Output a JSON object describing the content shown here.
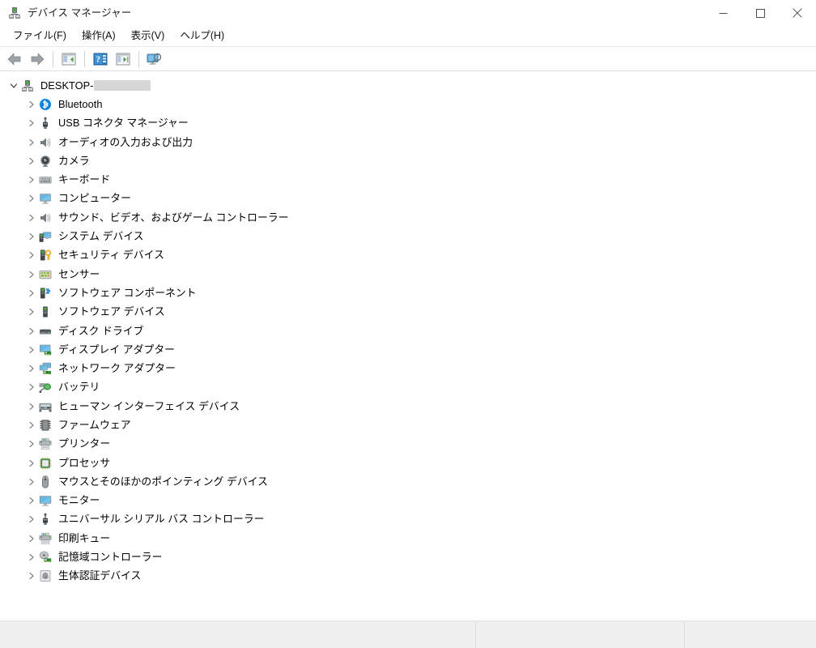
{
  "window": {
    "title": "デバイス マネージャー",
    "icon": "device-manager-icon",
    "controls": {
      "minimize": "最小化",
      "maximize": "最大化",
      "close": "閉じる"
    }
  },
  "menubar": {
    "items": [
      {
        "label": "ファイル(F)",
        "name": "menu-file"
      },
      {
        "label": "操作(A)",
        "name": "menu-action"
      },
      {
        "label": "表示(V)",
        "name": "menu-view"
      },
      {
        "label": "ヘルプ(H)",
        "name": "menu-help"
      }
    ]
  },
  "toolbar": {
    "buttons": [
      {
        "name": "back-button",
        "icon": "back-arrow-icon",
        "title": "戻る"
      },
      {
        "name": "forward-button",
        "icon": "forward-arrow-icon",
        "title": "進む"
      },
      {
        "name": "show-hide-console-tree-button",
        "icon": "console-tree-icon",
        "title": "コンソール ツリーの表示/非表示"
      },
      {
        "name": "help-button",
        "icon": "help-icon",
        "title": "ヘルプ"
      },
      {
        "name": "properties-button",
        "icon": "properties-icon",
        "title": "プロパティ"
      },
      {
        "name": "scan-hardware-changes-button",
        "icon": "scan-hardware-icon",
        "title": "ハードウェア変更のスキャン"
      }
    ]
  },
  "tree": {
    "root": {
      "label_prefix": "DESKTOP-",
      "label_redacted": true,
      "icon": "computer-root-icon",
      "expanded": true
    },
    "nodes": [
      {
        "label": "Bluetooth",
        "icon": "bluetooth-icon"
      },
      {
        "label": "USB コネクタ マネージャー",
        "icon": "usb-connector-icon"
      },
      {
        "label": "オーディオの入力および出力",
        "icon": "audio-icon"
      },
      {
        "label": "カメラ",
        "icon": "camera-icon"
      },
      {
        "label": "キーボード",
        "icon": "keyboard-icon"
      },
      {
        "label": "コンピューター",
        "icon": "computer-icon"
      },
      {
        "label": "サウンド、ビデオ、およびゲーム コントローラー",
        "icon": "audio-icon"
      },
      {
        "label": "システム デバイス",
        "icon": "system-device-icon"
      },
      {
        "label": "セキュリティ デバイス",
        "icon": "security-device-icon"
      },
      {
        "label": "センサー",
        "icon": "sensor-icon"
      },
      {
        "label": "ソフトウェア コンポーネント",
        "icon": "software-component-icon"
      },
      {
        "label": "ソフトウェア デバイス",
        "icon": "software-device-icon"
      },
      {
        "label": "ディスク ドライブ",
        "icon": "disk-drive-icon"
      },
      {
        "label": "ディスプレイ アダプター",
        "icon": "display-adapter-icon"
      },
      {
        "label": "ネットワーク アダプター",
        "icon": "network-adapter-icon"
      },
      {
        "label": "バッテリ",
        "icon": "battery-icon"
      },
      {
        "label": "ヒューマン インターフェイス デバイス",
        "icon": "hid-icon"
      },
      {
        "label": "ファームウェア",
        "icon": "firmware-icon"
      },
      {
        "label": "プリンター",
        "icon": "printer-icon"
      },
      {
        "label": "プロセッサ",
        "icon": "processor-icon"
      },
      {
        "label": "マウスとそのほかのポインティング デバイス",
        "icon": "mouse-icon"
      },
      {
        "label": "モニター",
        "icon": "monitor-icon"
      },
      {
        "label": "ユニバーサル シリアル バス コントローラー",
        "icon": "usb-controller-icon"
      },
      {
        "label": "印刷キュー",
        "icon": "print-queue-icon"
      },
      {
        "label": "記憶域コントローラー",
        "icon": "storage-controller-icon"
      },
      {
        "label": "生体認証デバイス",
        "icon": "biometric-icon"
      }
    ]
  },
  "statusbar": {
    "pane1": "",
    "pane2": "",
    "pane3": ""
  },
  "colors": {
    "window_bg": "#ffffff",
    "statusbar_bg": "#f0f0f0",
    "text": "#000000",
    "accent_blue": "#1e90d8",
    "bluetooth_blue": "#0a84e0",
    "separator": "#dcdcdc"
  }
}
